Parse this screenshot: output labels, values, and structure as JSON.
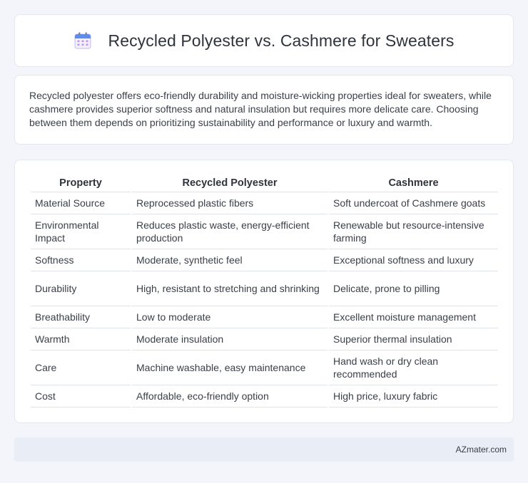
{
  "header": {
    "title": "Recycled Polyester vs. Cashmere for Sweaters",
    "icon": "calendar-icon"
  },
  "intro": {
    "text": "Recycled polyester offers eco-friendly durability and moisture-wicking properties ideal for sweaters, while cashmere provides superior softness and natural insulation but requires more delicate care. Choosing between them depends on prioritizing sustainability and performance or luxury and warmth."
  },
  "table": {
    "headers": [
      "Property",
      "Recycled Polyester",
      "Cashmere"
    ],
    "rows": [
      [
        "Material Source",
        "Reprocessed plastic fibers",
        "Soft undercoat of Cashmere goats"
      ],
      [
        "Environmental Impact",
        "Reduces plastic waste, energy-efficient production",
        "Renewable but resource-intensive farming"
      ],
      [
        "Softness",
        "Moderate, synthetic feel",
        "Exceptional softness and luxury"
      ],
      [
        "Durability",
        "High, resistant to stretching and shrinking",
        "Delicate, prone to pilling"
      ],
      [
        "Breathability",
        "Low to moderate",
        "Excellent moisture management"
      ],
      [
        "Warmth",
        "Moderate insulation",
        "Superior thermal insulation"
      ],
      [
        "Care",
        "Machine washable, easy maintenance",
        "Hand wash or dry clean recommended"
      ],
      [
        "Cost",
        "Affordable, eco-friendly option",
        "High price, luxury fabric"
      ]
    ]
  },
  "footer": {
    "text": "AZmater.com"
  }
}
